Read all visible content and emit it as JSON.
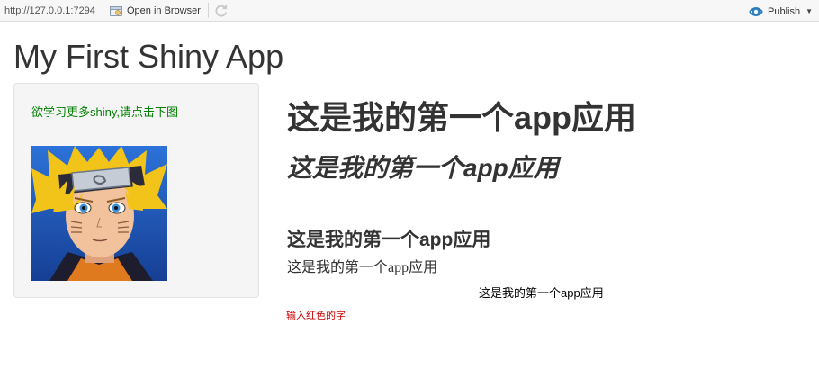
{
  "toolbar": {
    "url": "http://127.0.0.1:7294",
    "open_in_browser": "Open in Browser",
    "publish": "Publish"
  },
  "page": {
    "title": "My First Shiny App"
  },
  "sidebar": {
    "text": "欲学习更多shiny,请点击下图",
    "image_description": "naruto-portrait"
  },
  "main": {
    "heading_pre": "这是我的第一个",
    "heading_bold": "app",
    "heading_post": "应用",
    "italic": "这是我的第一个app应用",
    "medium": "这是我的第一个app应用",
    "small": "这是我的第一个app应用",
    "centered": "这是我的第一个app应用",
    "red": "输入红色的字"
  },
  "colors": {
    "green_text": "#008000",
    "red_text": "#cc0000",
    "publish_icon": "#2a7fc1"
  }
}
